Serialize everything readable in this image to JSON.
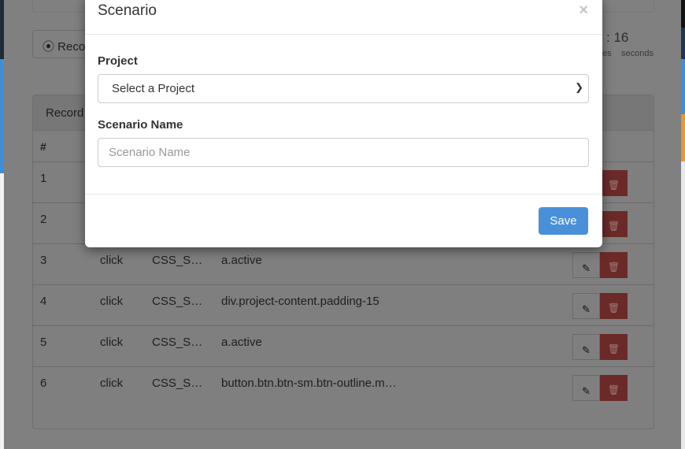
{
  "background": {
    "record_button_label": "Reco",
    "timer_value": ": 16",
    "timer_unit_partial": "es",
    "timer_unit": "seconds",
    "panel_title": "Record",
    "table_header": "#",
    "rows": [
      {
        "num": "1",
        "action": "",
        "type": "",
        "selector": ""
      },
      {
        "num": "2",
        "action": "",
        "type": "",
        "selector": ""
      },
      {
        "num": "3",
        "action": "click",
        "type": "CSS_S…",
        "selector": "a.active"
      },
      {
        "num": "4",
        "action": "click",
        "type": "CSS_S…",
        "selector": "div.project-content.padding-15"
      },
      {
        "num": "5",
        "action": "click",
        "type": "CSS_S…",
        "selector": "a.active"
      },
      {
        "num": "6",
        "action": "click",
        "type": "CSS_S…",
        "selector": "button.btn.btn-sm.btn-outline.m…"
      }
    ]
  },
  "modal": {
    "title": "Scenario",
    "close_symbol": "×",
    "project_label": "Project",
    "project_selected": "Select a Project",
    "scenario_name_label": "Scenario Name",
    "scenario_name_placeholder": "Scenario Name",
    "scenario_name_value": "",
    "save_label": "Save"
  },
  "colors": {
    "save": "#4a90d9",
    "delete": "#d9534f",
    "overlay": "rgba(0,0,0,0.5)"
  }
}
